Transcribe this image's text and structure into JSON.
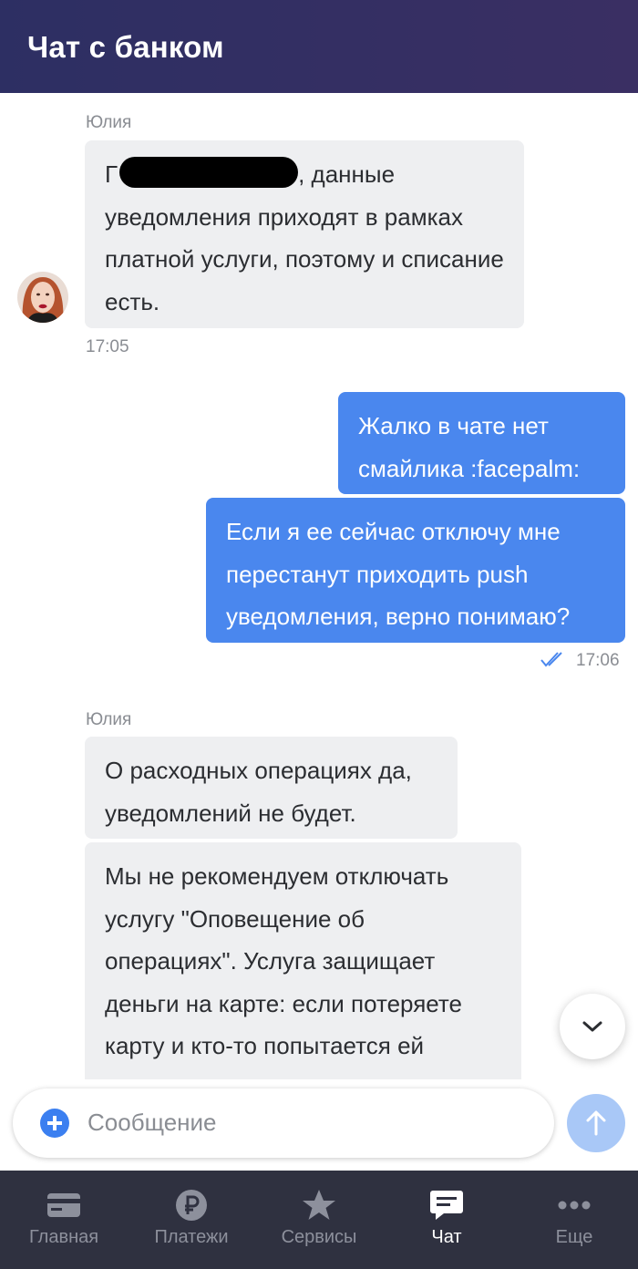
{
  "header": {
    "title": "Чат с банком"
  },
  "messages": [
    {
      "sender": "Юлия",
      "text_after_redaction": ", данные",
      "text_rest": "уведомления приходят в рамках платной услуги, поэтому и списание есть.",
      "time": "17:05"
    },
    {
      "text": "Жалко в чате нет смайлика :facepalm:"
    },
    {
      "text": "Если я ее сейчас отключу мне перестанут приходить push уведомления, верно понимаю?",
      "time": "17:06"
    },
    {
      "sender": "Юлия",
      "text": "О расходных операциях да, уведомлений не будет."
    },
    {
      "text": "Мы не рекомендуем отключать услугу \"Оповещение об операциях\". Услуга защищает деньги на карте: если потеряете карту и кто-то попытается ей"
    }
  ],
  "input": {
    "placeholder": "Сообщение"
  },
  "nav": {
    "items": [
      {
        "label": "Главная",
        "icon": "card-icon"
      },
      {
        "label": "Платежи",
        "icon": "ruble-icon"
      },
      {
        "label": "Сервисы",
        "icon": "star-icon"
      },
      {
        "label": "Чат",
        "icon": "chat-icon",
        "active": true
      },
      {
        "label": "Еще",
        "icon": "more-icon"
      }
    ]
  },
  "colors": {
    "header": "#2d2f63",
    "bubble_out": "#4a87ee",
    "bubble_in": "#eeeff1",
    "nav_bg": "#2f3140"
  }
}
